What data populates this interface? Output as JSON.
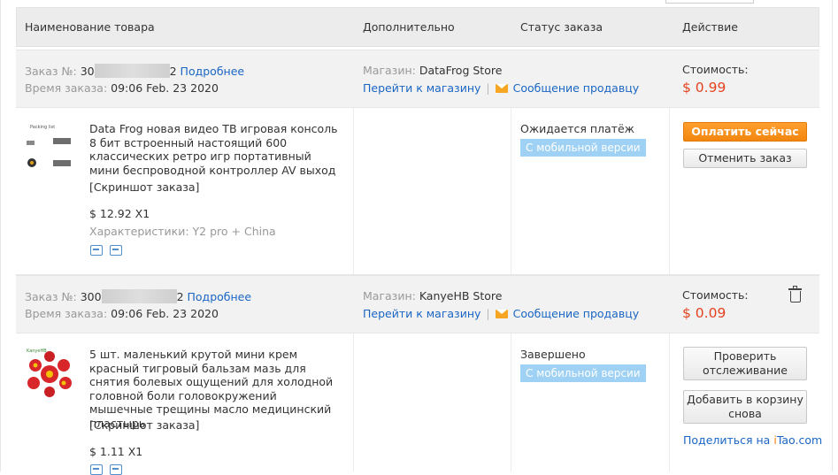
{
  "header": {
    "col_product": "Наименование товара",
    "col_extra": "Дополнительно",
    "col_status": "Статус заказа",
    "col_action": "Действие"
  },
  "orders": [
    {
      "order_label": "Заказ №:",
      "order_prefix": "30",
      "order_suffix": "2",
      "details_link": "Подробнее",
      "time_label": "Время заказа:",
      "time_value": "09:06 Feb. 23 2020",
      "store_label": "Магазин:",
      "store_name": "DataFrog Store",
      "store_link": "Перейти к магазину",
      "message_link": "Сообщение продавцу",
      "cost_label": "Стоимость:",
      "cost_value": "$ 0.99",
      "product_title": "Data Frog новая видео ТВ игровая консоль 8 бит встроенный настоящий 600 классических ретро игр портативный мини беспроводной контроллер AV выход",
      "screenshot_link": "[Скриншот заказа]",
      "price_qty": "$ 12.92 X1",
      "specs_label": "Характеристики:",
      "specs_value": "Y2 pro + China",
      "status": "Ожидается платёж",
      "badge": "С мобильной версии",
      "pay_button": "Оплатить сейчас",
      "cancel_button": "Отменить заказ",
      "thumb_caption": "Packing list"
    },
    {
      "order_label": "Заказ №:",
      "order_prefix": "300",
      "order_suffix": "2",
      "details_link": "Подробнее",
      "time_label": "Время заказа:",
      "time_value": "09:06 Feb. 23 2020",
      "store_label": "Магазин:",
      "store_name": "KanyeHB Store",
      "store_link": "Перейти к магазину",
      "message_link": "Сообщение продавцу",
      "cost_label": "Стоимость:",
      "cost_value": "$ 0.09",
      "product_title": "5 шт. маленький крутой мини крем красный тигровый бальзам мазь для снятия болевых ощущений для холодной головной боли головокружений мышечные трещины масло медицинский пластырь",
      "screenshot_link": "[Скриншот заказа]",
      "price_qty": "$ 1.11 X1",
      "status": "Завершено",
      "badge": "С мобильной версии",
      "track_button": "Проверить отслеживание",
      "cart_button": "Добавить в корзину снова",
      "share_text": "Поделиться на ",
      "share_brand_i": "i",
      "share_brand_rest": "Tao.com",
      "thumb_caption": "KanyeHB"
    }
  ],
  "colors": {
    "accent_orange": "#f2860f",
    "price_red": "#e5431f",
    "link_blue": "#1a66c4",
    "badge_blue": "#9fd1f5"
  }
}
